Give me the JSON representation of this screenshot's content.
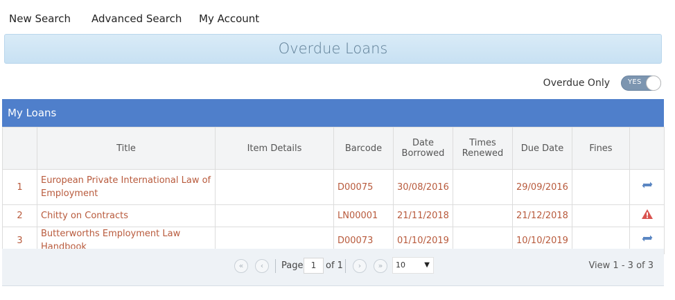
{
  "nav": {
    "new_search": "New Search",
    "advanced_search": "Advanced Search",
    "my_account": "My Account"
  },
  "page_title": "Overdue Loans",
  "filter": {
    "label": "Overdue Only",
    "toggle_value": "YES"
  },
  "panel_title": "My Loans",
  "columns": [
    "",
    "Title",
    "Item Details",
    "Barcode",
    "Date Borrowed",
    "Times Renewed",
    "Due Date",
    "Fines",
    ""
  ],
  "rows": [
    {
      "num": "1",
      "title": "European Private International Law of Employment",
      "details": "",
      "barcode": "D00075",
      "borrowed": "30/08/2016",
      "renewed": "",
      "due": "29/09/2016",
      "fines": "",
      "action_icon": "renew-icon"
    },
    {
      "num": "2",
      "title": "Chitty on Contracts",
      "details": "",
      "barcode": "LN00001",
      "borrowed": "21/11/2018",
      "renewed": "",
      "due": "21/12/2018",
      "fines": "",
      "action_icon": "warning-icon"
    },
    {
      "num": "3",
      "title": "Butterworths Employment Law Handbook",
      "details": "",
      "barcode": "D00073",
      "borrowed": "01/10/2019",
      "renewed": "",
      "due": "10/10/2019",
      "fines": "",
      "action_icon": "renew-icon"
    }
  ],
  "pager": {
    "page_label": "Page",
    "page_value": "1",
    "of_label": "of 1",
    "page_size": "10",
    "view_text": "View 1 - 3 of 3"
  },
  "colors": {
    "header_blue": "#4f7fcb",
    "link": "#b85a3c",
    "icon_blue": "#5a86c2",
    "warning_red": "#d9534f"
  }
}
